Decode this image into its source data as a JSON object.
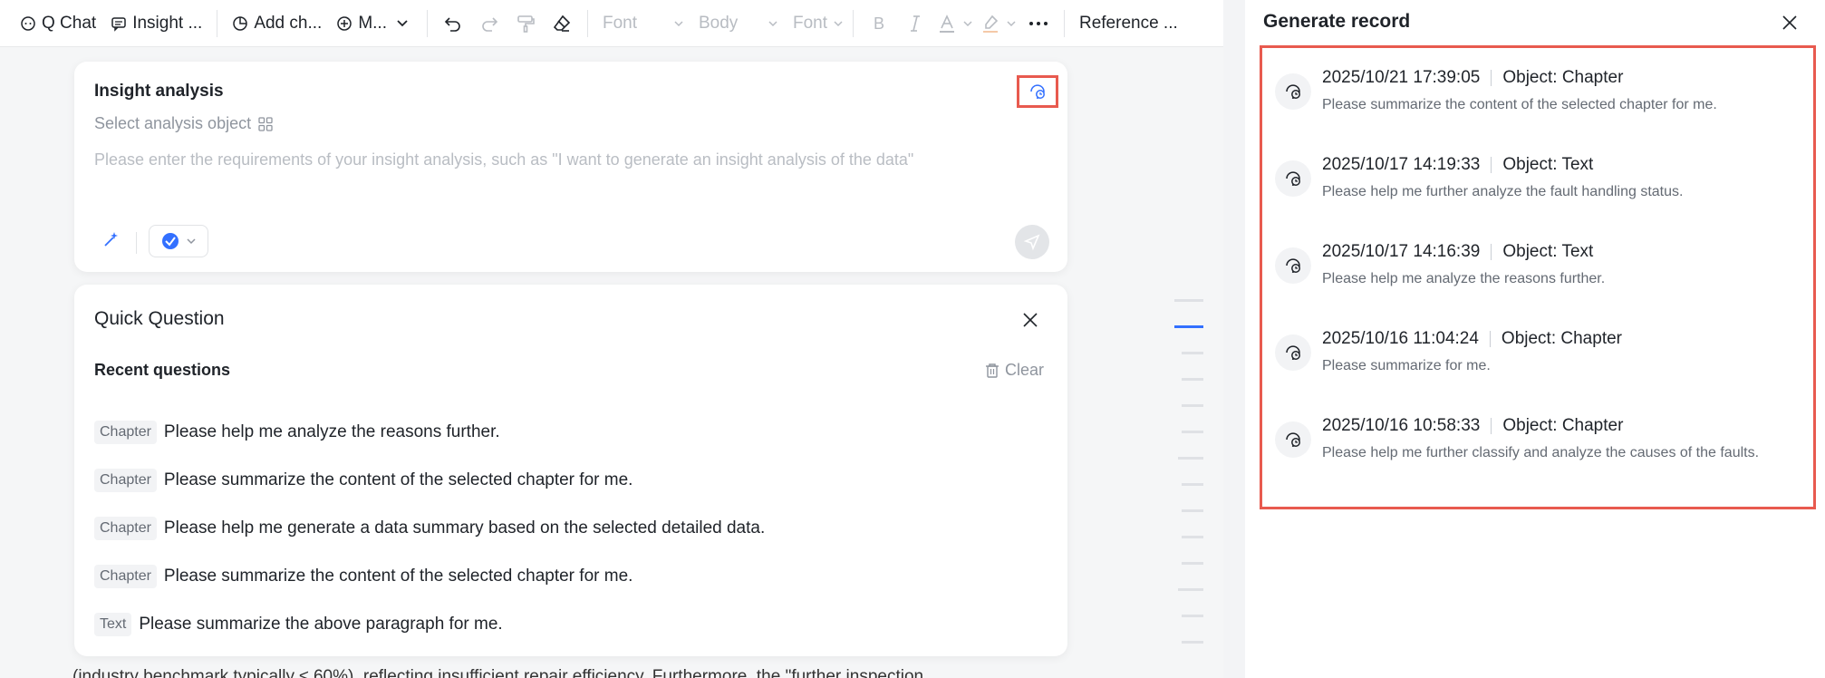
{
  "toolbar": {
    "q_chat": "Q Chat",
    "insight": "Insight ...",
    "add_chart": "Add ch...",
    "more": "M...",
    "font": "Font",
    "body": "Body",
    "font_size": "Font",
    "reference": "Reference ..."
  },
  "document": {
    "background_text": "(industry benchmark typically ≤ 60%), reflecting insufficient repair efficiency. Furthermore, the \"further inspection"
  },
  "insight": {
    "title": "Insight analysis",
    "select_object": "Select analysis object",
    "input_placeholder": "Please enter the requirements of your insight analysis, such as \"I want to generate an insight analysis of the data\""
  },
  "quick_question": {
    "title": "Quick Question",
    "recent_label": "Recent questions",
    "clear_label": "Clear",
    "items": [
      {
        "tag": "Chapter",
        "text": "Please help me analyze the reasons further."
      },
      {
        "tag": "Chapter",
        "text": "Please summarize the content of the selected chapter for me."
      },
      {
        "tag": "Chapter",
        "text": "Please help me generate a data summary based on the selected detailed data."
      },
      {
        "tag": "Chapter",
        "text": "Please summarize the content of the selected chapter for me."
      },
      {
        "tag": "Text",
        "text": "Please summarize the above paragraph for me."
      }
    ]
  },
  "panel": {
    "title": "Generate record",
    "records": [
      {
        "time": "2025/10/21 17:39:05",
        "object": "Object: Chapter",
        "desc": "Please summarize the content of the selected chapter for me."
      },
      {
        "time": "2025/10/17 14:19:33",
        "object": "Object: Text",
        "desc": "Please help me further analyze the fault handling status."
      },
      {
        "time": "2025/10/17 14:16:39",
        "object": "Object: Text",
        "desc": "Please help me analyze the reasons further."
      },
      {
        "time": "2025/10/16 11:04:24",
        "object": "Object: Chapter",
        "desc": "Please summarize for me."
      },
      {
        "time": "2025/10/16 10:58:33",
        "object": "Object: Chapter",
        "desc": "Please help me further classify and analyze the causes of the faults."
      }
    ]
  },
  "colors": {
    "accent": "#3370ff",
    "highlight_border": "#e85a4f"
  }
}
